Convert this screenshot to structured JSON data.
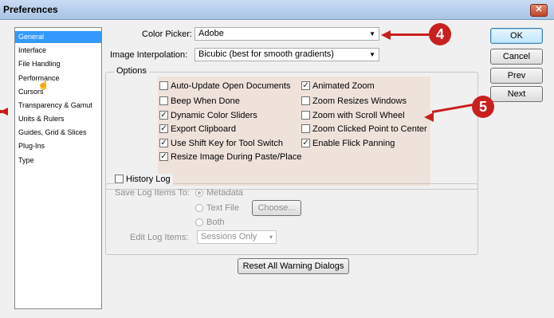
{
  "window": {
    "title": "Preferences",
    "close_label": "✕"
  },
  "sidebar": {
    "items": [
      {
        "label": "General",
        "selected": true
      },
      {
        "label": "Interface"
      },
      {
        "label": "File Handling"
      },
      {
        "label": "Performance"
      },
      {
        "label": "Cursors"
      },
      {
        "label": "Transparency & Gamut"
      },
      {
        "label": "Units & Rulers"
      },
      {
        "label": "Guides, Grid & Slices"
      },
      {
        "label": "Plug-Ins"
      },
      {
        "label": "Type"
      }
    ]
  },
  "general": {
    "color_picker_label": "Color Picker:",
    "color_picker_value": "Adobe",
    "interp_label": "Image Interpolation:",
    "interp_value": "Bicubic (best for smooth gradients)"
  },
  "options": {
    "title": "Options",
    "left": [
      {
        "label": "Auto-Update Open Documents",
        "checked": false
      },
      {
        "label": "Beep When Done",
        "checked": false
      },
      {
        "label": "Dynamic Color Sliders",
        "checked": true
      },
      {
        "label": "Export Clipboard",
        "checked": true
      },
      {
        "label": "Use Shift Key for Tool Switch",
        "checked": true
      },
      {
        "label": "Resize Image During Paste/Place",
        "checked": true
      }
    ],
    "right": [
      {
        "label": "Animated Zoom",
        "checked": true
      },
      {
        "label": "Zoom Resizes Windows",
        "checked": false
      },
      {
        "label": "Zoom with Scroll Wheel",
        "checked": false
      },
      {
        "label": "Zoom Clicked Point to Center",
        "checked": false
      },
      {
        "label": "Enable Flick Panning",
        "checked": true
      }
    ]
  },
  "history": {
    "title": "History Log",
    "save_label": "Save Log Items To:",
    "radio_metadata": "Metadata",
    "radio_textfile": "Text File",
    "choose_button": "Choose...",
    "radio_both": "Both",
    "edit_label": "Edit Log Items:",
    "edit_value": "Sessions Only"
  },
  "reset_button": "Reset All Warning Dialogs",
  "buttons": {
    "ok": "OK",
    "cancel": "Cancel",
    "prev": "Prev",
    "next": "Next"
  },
  "callouts": {
    "four": "4",
    "five": "5"
  },
  "colors": {
    "accent": "#3399ff",
    "callout": "#c8201e",
    "options_highlight": "#efe2db"
  }
}
